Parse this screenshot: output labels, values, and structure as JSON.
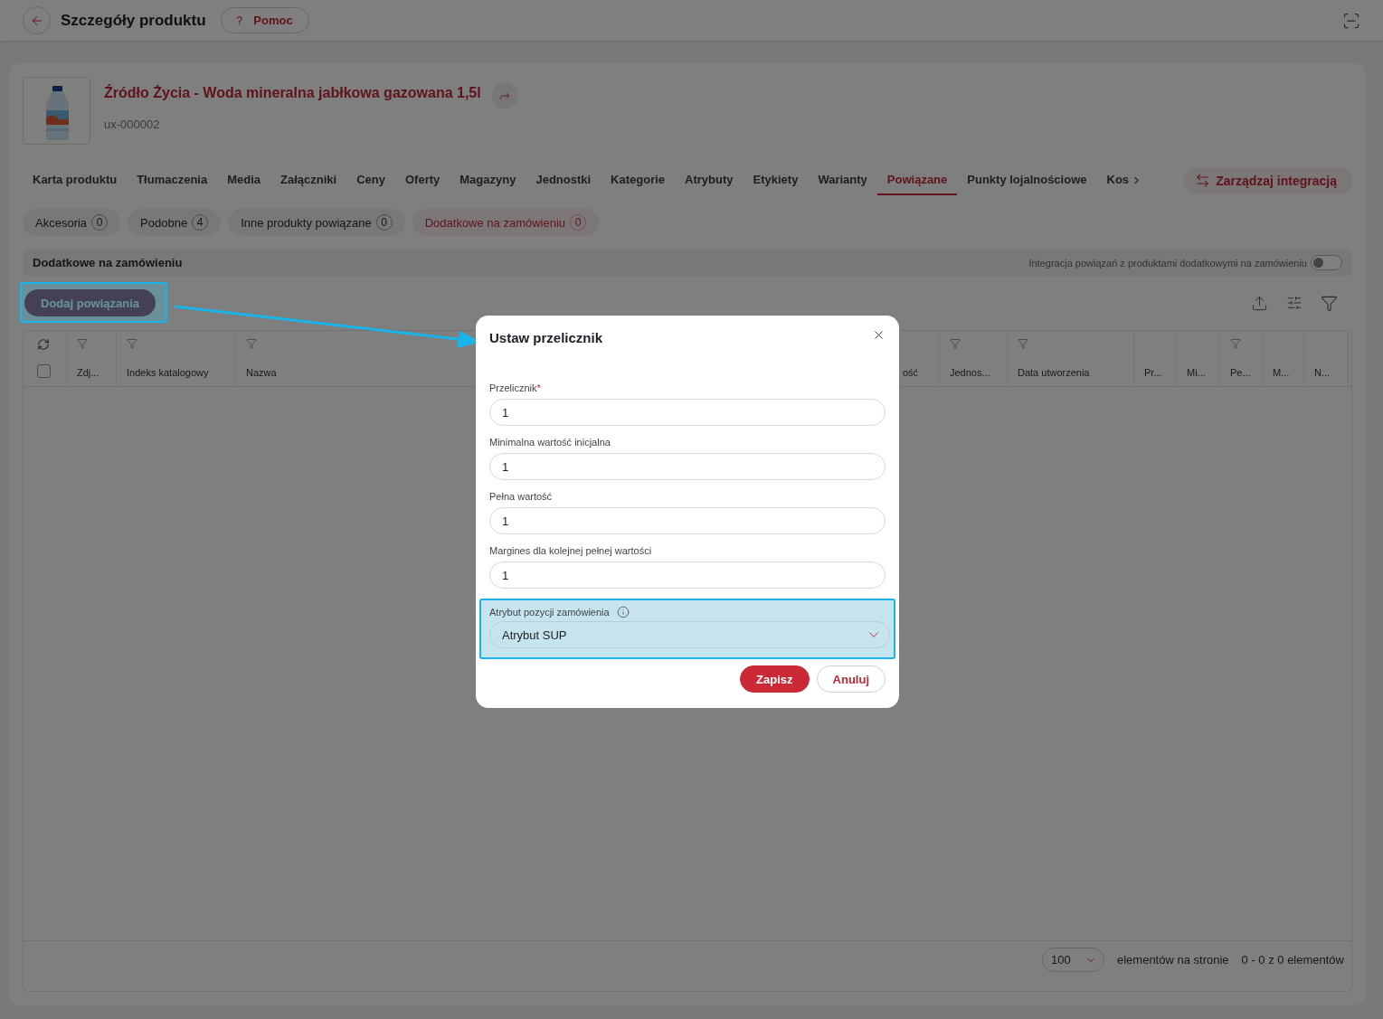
{
  "header": {
    "title": "Szczegóły produktu",
    "help": {
      "glyph": "?",
      "label": "Pomoc"
    }
  },
  "product": {
    "name": "Źródło Życia - Woda mineralna jabłkowa gazowana 1,5l",
    "sku": "ux-000002"
  },
  "tabs": [
    {
      "label": "Karta produktu",
      "selected": false
    },
    {
      "label": "Tłumaczenia",
      "selected": false
    },
    {
      "label": "Media",
      "selected": false
    },
    {
      "label": "Załączniki",
      "selected": false
    },
    {
      "label": "Ceny",
      "selected": false
    },
    {
      "label": "Oferty",
      "selected": false
    },
    {
      "label": "Magazyny",
      "selected": false
    },
    {
      "label": "Jednostki",
      "selected": false
    },
    {
      "label": "Kategorie",
      "selected": false
    },
    {
      "label": "Atrybuty",
      "selected": false
    },
    {
      "label": "Etykiety",
      "selected": false
    },
    {
      "label": "Warianty",
      "selected": false
    },
    {
      "label": "Powiązane",
      "selected": true
    },
    {
      "label": "Punkty lojalnościowe",
      "selected": false
    },
    {
      "label": "Kos",
      "selected": false
    }
  ],
  "integration_button": "Zarządzaj integracją",
  "subtabs": [
    {
      "label": "Akcesoria",
      "count": "0",
      "selected": false
    },
    {
      "label": "Podobne",
      "count": "4",
      "selected": false
    },
    {
      "label": "Inne produkty powiązane",
      "count": "0",
      "selected": false
    },
    {
      "label": "Dodatkowe na zamówieniu",
      "count": "0",
      "selected": true
    }
  ],
  "section": {
    "title": "Dodatkowe na zamówieniu",
    "toggle_label": "Integracja powiązań z produktami dodatkowymi na zamówieniu",
    "toggle_on": false
  },
  "add_button": "Dodaj powiązania",
  "table": {
    "columns": [
      {
        "label": "Zdj...",
        "filterable": true
      },
      {
        "label": "Indeks katalogowy",
        "filterable": true
      },
      {
        "label": "Nazwa",
        "filterable": true
      },
      {
        "label": "ość",
        "filterable": false
      },
      {
        "label": "Jednos...",
        "filterable": true
      },
      {
        "label": "Data utworzenia",
        "filterable": true
      },
      {
        "label": "Pr...",
        "filterable": false
      },
      {
        "label": "Mi...",
        "filterable": false
      },
      {
        "label": "Pe...",
        "filterable": true
      },
      {
        "label": "M...",
        "filterable": false
      },
      {
        "label": "N...",
        "filterable": false
      }
    ],
    "select_all": false,
    "page_size": "100",
    "page_size_label": "elementów na stronie",
    "range": "0 - 0 z 0 elementów"
  },
  "dialog": {
    "title": "Ustaw przelicznik",
    "fields": [
      {
        "kind": "input",
        "label": "Przelicznik",
        "required_mark": "*",
        "value": "1"
      },
      {
        "kind": "input",
        "label": "Minimalna wartość inicjalna",
        "value": "1"
      },
      {
        "kind": "input",
        "label": "Pełna wartość",
        "value": "1"
      },
      {
        "kind": "input",
        "label": "Margines dla kolejnej pełnej wartości",
        "value": "1"
      },
      {
        "kind": "select",
        "label": "Atrybut pozycji zamówienia",
        "info": true,
        "highlighted": true,
        "value": "Atrybut SUP"
      }
    ],
    "buttons": [
      {
        "kind": "primary",
        "label": "Zapisz"
      },
      {
        "kind": "secondary",
        "label": "Anuluj"
      }
    ]
  }
}
